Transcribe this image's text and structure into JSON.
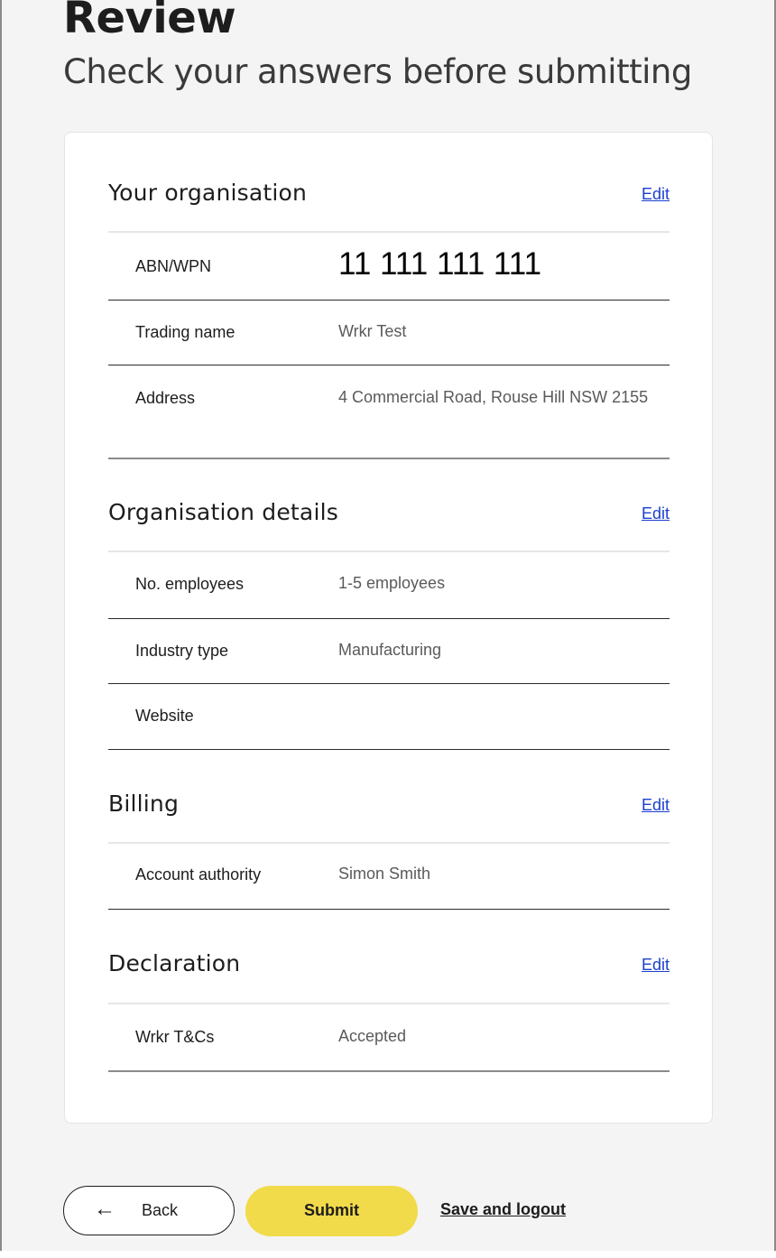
{
  "header": {
    "title": "Review",
    "subtitle": "Check your answers before submitting"
  },
  "sections": [
    {
      "title": "Your organisation",
      "edit_label": "Edit",
      "rows": [
        {
          "label": "ABN/WPN",
          "value": "11 111 111 111"
        },
        {
          "label": "Trading name",
          "value": "Wrkr Test"
        },
        {
          "label": "Address",
          "value": "4 Commercial Road, Rouse Hill NSW 2155"
        }
      ]
    },
    {
      "title": "Organisation details",
      "edit_label": "Edit",
      "rows": [
        {
          "label": "No. employees",
          "value": "1-5 employees"
        },
        {
          "label": "Industry type",
          "value": "Manufacturing"
        },
        {
          "label": "Website",
          "value": ""
        }
      ]
    },
    {
      "title": "Billing",
      "edit_label": "Edit",
      "rows": [
        {
          "label": "Account authority",
          "value": "Simon Smith"
        }
      ]
    },
    {
      "title": "Declaration",
      "edit_label": "Edit",
      "rows": [
        {
          "label": "Wrkr T&Cs",
          "value": "Accepted"
        }
      ]
    }
  ],
  "footer": {
    "back_label": "Back",
    "back_icon": "arrow-left-icon",
    "submit_label": "Submit",
    "save_logout_label": "Save and logout"
  },
  "colors": {
    "background": "#f4f4f4",
    "submit": "#f1db4b",
    "link": "#1a3fcf"
  }
}
